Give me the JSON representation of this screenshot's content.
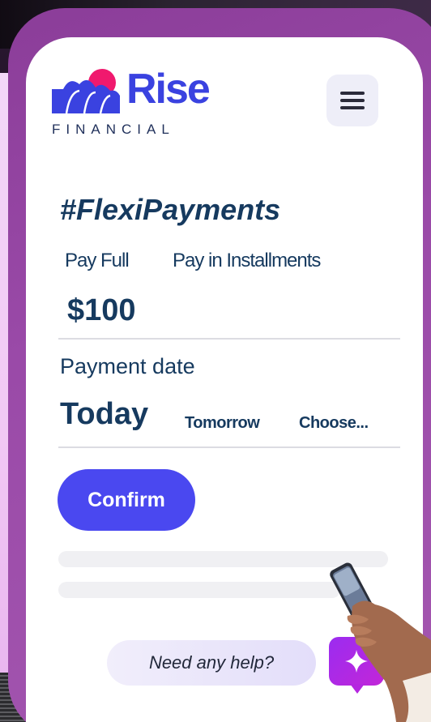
{
  "brand": {
    "name": "Rise",
    "subtitle": "FINANCIAL",
    "accent": "#3a42e0",
    "sun_color": "#f0196e"
  },
  "header": {
    "menu_icon": "hamburger-menu-icon"
  },
  "payment": {
    "hashtag": "#FlexiPayments",
    "options": [
      "Pay Full",
      "Pay in Installments"
    ],
    "amount": "$100",
    "date_label": "Payment date",
    "dates": {
      "selected": "Today",
      "tomorrow": "Tomorrow",
      "choose": "Choose..."
    },
    "confirm_label": "Confirm",
    "confirm_color": "#4a48f0"
  },
  "help": {
    "text": "Need any help?",
    "icon": "sparkle-icon",
    "color": "#a32be8"
  }
}
